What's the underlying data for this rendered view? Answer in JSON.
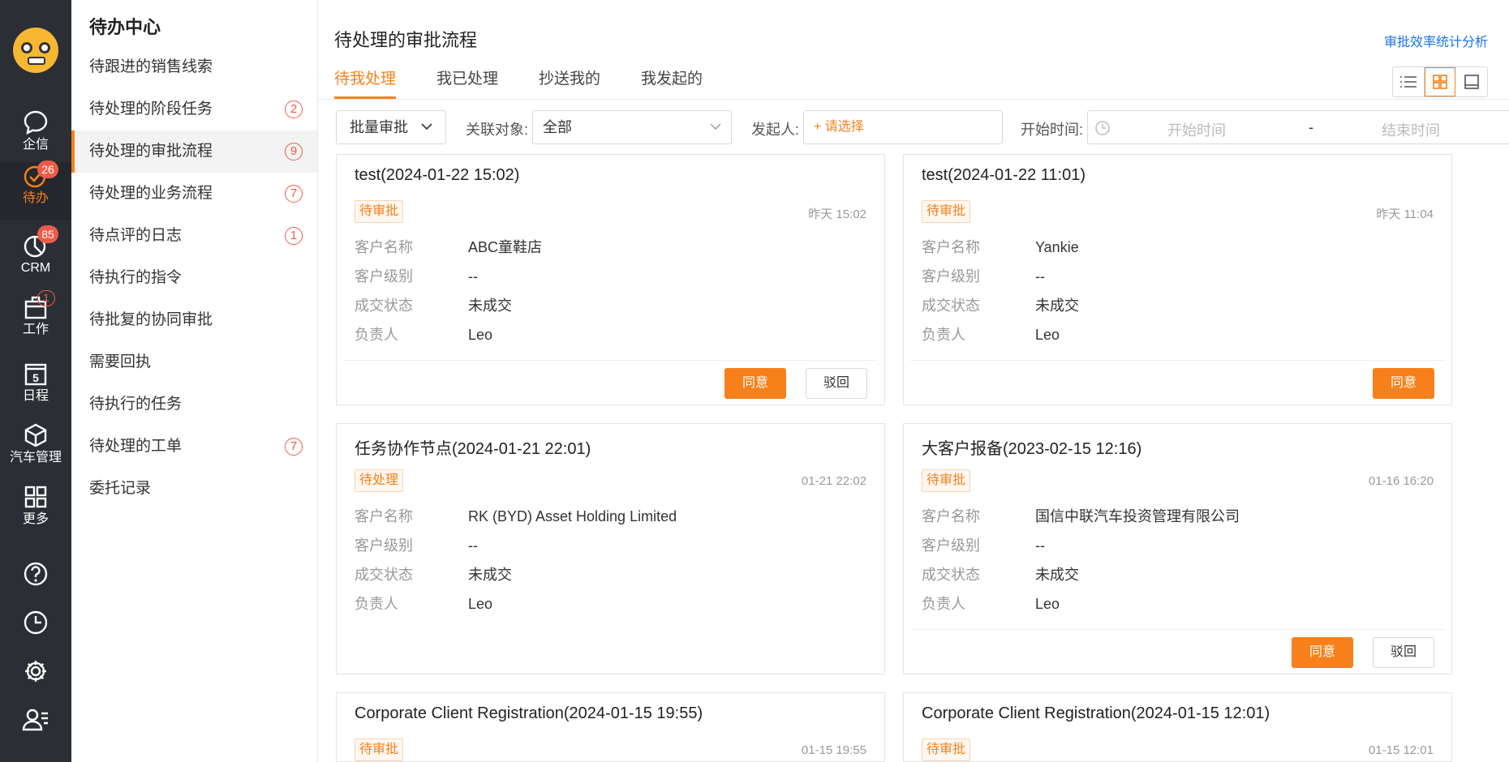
{
  "rail": {
    "items": [
      {
        "label": "企信",
        "icon": "chat-icon",
        "badge": ""
      },
      {
        "label": "待办",
        "icon": "todo-check-icon",
        "badge": "26"
      },
      {
        "label": "CRM",
        "icon": "crm-pie-icon",
        "badge": "85"
      },
      {
        "label": "工作",
        "icon": "briefcase-icon",
        "badge": "1"
      },
      {
        "label": "日程",
        "icon": "calendar-icon",
        "badge": "",
        "calendar_day": "5"
      },
      {
        "label": "汽车管理",
        "icon": "cube-icon",
        "badge": ""
      },
      {
        "label": "更多",
        "icon": "grid-icon",
        "badge": ""
      }
    ],
    "tools": [
      "help-icon",
      "history-clock-icon",
      "settings-gear-icon",
      "user-list-icon"
    ]
  },
  "sidebar": {
    "title": "待办中心",
    "items": [
      {
        "label": "待跟进的销售线索",
        "count": ""
      },
      {
        "label": "待处理的阶段任务",
        "count": "2"
      },
      {
        "label": "待处理的审批流程",
        "count": "9"
      },
      {
        "label": "待处理的业务流程",
        "count": "7"
      },
      {
        "label": "待点评的日志",
        "count": "1"
      },
      {
        "label": "待执行的指令",
        "count": ""
      },
      {
        "label": "待批复的协同审批",
        "count": ""
      },
      {
        "label": "需要回执",
        "count": ""
      },
      {
        "label": "待执行的任务",
        "count": ""
      },
      {
        "label": "待处理的工单",
        "count": "7"
      },
      {
        "label": "委托记录",
        "count": ""
      }
    ]
  },
  "main": {
    "title": "待处理的审批流程",
    "stats_link": "审批效率统计分析",
    "tabs": [
      "待我处理",
      "我已处理",
      "抄送我的",
      "我发起的"
    ],
    "filters": {
      "batch": "批量审批",
      "related_label": "关联对象:",
      "related_value": "全部",
      "initiator_label": "发起人:",
      "initiator_placeholder": "+ 请选择",
      "start_label": "开始时间:",
      "start_placeholder": "开始时间",
      "range_sep": "-",
      "end_placeholder": "结束时间"
    },
    "cards": [
      {
        "title": "test(2024-01-22 15:02)",
        "tag": "待审批",
        "time": "昨天 15:02",
        "rows": [
          {
            "k": "客户名称",
            "v": "ABC童鞋店"
          },
          {
            "k": "客户级别",
            "v": "--"
          },
          {
            "k": "成交状态",
            "v": "未成交"
          },
          {
            "k": "负责人",
            "v": "Leo"
          }
        ],
        "agree": "同意",
        "reject": "驳回"
      },
      {
        "title": "test(2024-01-22 11:01)",
        "tag": "待审批",
        "time": "昨天 11:04",
        "rows": [
          {
            "k": "客户名称",
            "v": "Yankie"
          },
          {
            "k": "客户级别",
            "v": "--"
          },
          {
            "k": "成交状态",
            "v": "未成交"
          },
          {
            "k": "负责人",
            "v": "Leo"
          }
        ],
        "agree": "同意",
        "reject": ""
      },
      {
        "title": "任务协作节点(2024-01-21 22:01)",
        "tag": "待处理",
        "time": "01-21 22:02",
        "rows": [
          {
            "k": "客户名称",
            "v": "RK (BYD) Asset Holding Limited"
          },
          {
            "k": "客户级别",
            "v": "--"
          },
          {
            "k": "成交状态",
            "v": "未成交"
          },
          {
            "k": "负责人",
            "v": "Leo"
          }
        ],
        "agree": "",
        "reject": ""
      },
      {
        "title": "大客户报备(2023-02-15 12:16)",
        "tag": "待审批",
        "time": "01-16 16:20",
        "rows": [
          {
            "k": "客户名称",
            "v": "国信中联汽车投资管理有限公司"
          },
          {
            "k": "客户级别",
            "v": "--"
          },
          {
            "k": "成交状态",
            "v": "未成交"
          },
          {
            "k": "负责人",
            "v": "Leo"
          }
        ],
        "agree": "同意",
        "reject": "驳回"
      },
      {
        "title": "Corporate Client Registration(2024-01-15 19:55)",
        "tag": "待审批",
        "time": "01-15 19:55",
        "rows": [],
        "agree": "",
        "reject": ""
      },
      {
        "title": "Corporate Client Registration(2024-01-15 12:01)",
        "tag": "待审批",
        "time": "01-15 12:01",
        "rows": [],
        "agree": "",
        "reject": ""
      }
    ]
  },
  "colors": {
    "accent": "#f7801a",
    "rail_bg": "#2b2e35",
    "badge": "#f05b48",
    "link": "#1a73e8"
  }
}
